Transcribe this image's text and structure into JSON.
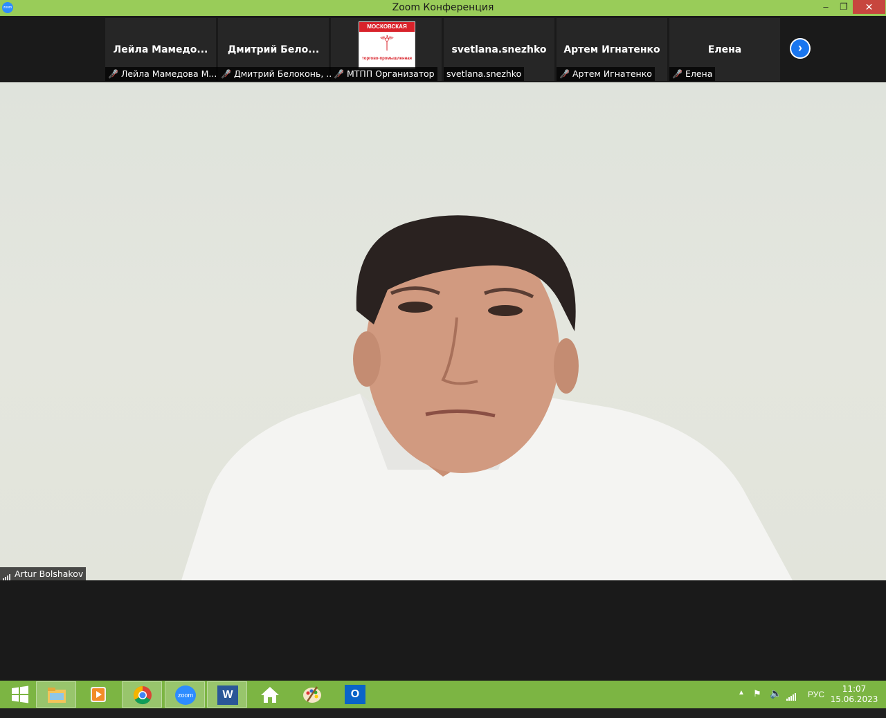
{
  "window": {
    "title": "Zoom Конференция",
    "app_icon_text": "zoom",
    "controls": {
      "minimize": "–",
      "restore": "❐",
      "close": "✕"
    }
  },
  "participants": [
    {
      "tile_name": "Лейла  Мамедо...",
      "label": "Лейла Мамедова М...",
      "muted": true
    },
    {
      "tile_name": "Дмитрий  Бело...",
      "label": "Дмитрий Белоконь, ...",
      "muted": true
    },
    {
      "tile_name": "",
      "label": "МТПП Организатор",
      "muted": true,
      "logo": {
        "top_text": "МОСКОВСКАЯ",
        "bottom_text": "торгово-промышленная"
      }
    },
    {
      "tile_name": "svetlana.snezhko",
      "label": "svetlana.snezhko",
      "muted": false
    },
    {
      "tile_name": "Артем Игнатенко",
      "label": "Артем Игнатенко",
      "muted": true
    },
    {
      "tile_name": "Елена",
      "label": "Елена",
      "muted": true
    }
  ],
  "strip": {
    "next_icon": "chevron-right-icon"
  },
  "speaker": {
    "name": "Artur Bolshakov"
  },
  "taskbar": {
    "items": [
      {
        "name": "windows-start",
        "icon": "windows-logo-icon"
      },
      {
        "name": "file-explorer",
        "icon": "folder-icon"
      },
      {
        "name": "media-player",
        "icon": "media-player-icon"
      },
      {
        "name": "chrome",
        "icon": "chrome-icon"
      },
      {
        "name": "zoom",
        "icon": "zoom-icon",
        "text": "zoom"
      },
      {
        "name": "word",
        "icon": "word-icon",
        "text": "W"
      },
      {
        "name": "home",
        "icon": "home-icon"
      },
      {
        "name": "paint",
        "icon": "palette-icon"
      },
      {
        "name": "outlook",
        "icon": "outlook-icon",
        "text": "O"
      }
    ],
    "tray": {
      "language": "РУС",
      "time": "11:07",
      "date": "15.06.2023"
    }
  },
  "colors": {
    "titlebar": "#99cc59",
    "taskbar": "#7cb543",
    "close_button": "#c7463e",
    "zoom_blue": "#2d8cff",
    "muted_mic": "#e2453c"
  }
}
